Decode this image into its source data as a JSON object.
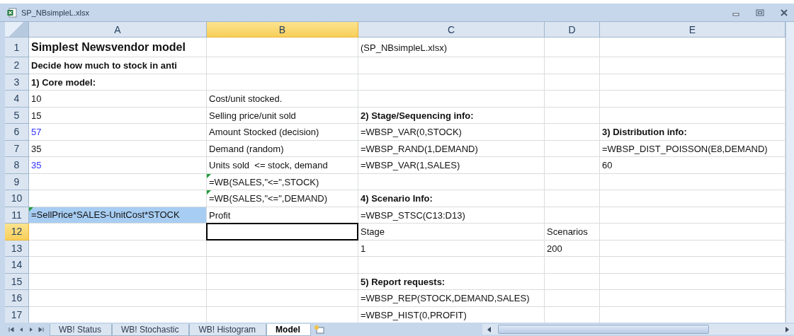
{
  "window": {
    "title": "SP_NBsimpleL.xlsx"
  },
  "columns": [
    {
      "label": "A",
      "selected": false
    },
    {
      "label": "B",
      "selected": true
    },
    {
      "label": "C",
      "selected": false
    },
    {
      "label": "D",
      "selected": false
    },
    {
      "label": "E",
      "selected": false
    }
  ],
  "rows": [
    {
      "label": "1",
      "selected": false,
      "a": {
        "text": "Simplest Newsvendor model",
        "kind": "title"
      },
      "c": {
        "text": "(SP_NBsimpleL.xlsx)",
        "kind": "text"
      }
    },
    {
      "label": "2",
      "selected": false,
      "a": {
        "text": "Decide how much to stock in anti",
        "kind": "heading"
      }
    },
    {
      "label": "3",
      "selected": false,
      "a": {
        "text": "1) Core model:",
        "kind": "heading"
      }
    },
    {
      "label": "4",
      "selected": false,
      "a": {
        "text": "10",
        "kind": "text"
      },
      "b": {
        "text": "Cost/unit stocked.",
        "kind": "text"
      }
    },
    {
      "label": "5",
      "selected": false,
      "a": {
        "text": "15",
        "kind": "text"
      },
      "b": {
        "text": "Selling price/unit sold",
        "kind": "text"
      },
      "c": {
        "text": "2) Stage/Sequencing info:",
        "kind": "heading"
      }
    },
    {
      "label": "6",
      "selected": false,
      "a": {
        "text": "57",
        "kind": "text",
        "color": "#3333ff"
      },
      "b": {
        "text": "Amount Stocked (decision)",
        "kind": "text"
      },
      "c": {
        "text": "=WBSP_VAR(0,STOCK)",
        "kind": "text"
      },
      "e": {
        "text": "3) Distribution info:",
        "kind": "heading"
      }
    },
    {
      "label": "7",
      "selected": false,
      "a": {
        "text": "35",
        "kind": "text"
      },
      "b": {
        "text": "Demand (random)",
        "kind": "text"
      },
      "c": {
        "text": "=WBSP_RAND(1,DEMAND)",
        "kind": "text"
      },
      "e": {
        "text": "=WBSP_DIST_POISSON(E8,DEMAND)",
        "kind": "text"
      }
    },
    {
      "label": "8",
      "selected": false,
      "a": {
        "text": "35",
        "kind": "text",
        "color": "#3333ff"
      },
      "b": {
        "text": "Units sold  <= stock, demand",
        "kind": "text"
      },
      "c": {
        "text": "=WBSP_VAR(1,SALES)",
        "kind": "text"
      },
      "e": {
        "text": "60",
        "kind": "text"
      }
    },
    {
      "label": "9",
      "selected": false,
      "b": {
        "text": "=WB(SALES,\"<=\",STOCK)",
        "kind": "text",
        "flagged": true
      }
    },
    {
      "label": "10",
      "selected": false,
      "b": {
        "text": "=WB(SALES,\"<=\",DEMAND)",
        "kind": "text",
        "flagged": true
      },
      "c": {
        "text": "4) Scenario Info:",
        "kind": "heading"
      }
    },
    {
      "label": "11",
      "selected": false,
      "a": {
        "text": "=SellPrice*SALES-UnitCost*STOCK",
        "kind": "text",
        "flagged": true,
        "highlighted": true
      },
      "b": {
        "text": "Profit",
        "kind": "text"
      },
      "c": {
        "text": "=WBSP_STSC(C13:D13)",
        "kind": "text"
      }
    },
    {
      "label": "12",
      "selected": true,
      "b": {
        "kind": "text",
        "active": true
      },
      "c": {
        "text": "Stage",
        "kind": "text"
      },
      "d": {
        "text": "Scenarios",
        "kind": "text"
      }
    },
    {
      "label": "13",
      "selected": false,
      "c": {
        "text": "1",
        "kind": "text"
      },
      "d": {
        "text": "200",
        "kind": "text"
      }
    },
    {
      "label": "14",
      "selected": false
    },
    {
      "label": "15",
      "selected": false,
      "c": {
        "text": "5) Report requests:",
        "kind": "heading"
      }
    },
    {
      "label": "16",
      "selected": false,
      "c": {
        "text": "=WBSP_REP(STOCK,DEMAND,SALES)",
        "kind": "text"
      }
    },
    {
      "label": "17",
      "selected": false,
      "c": {
        "text": "=WBSP_HIST(0,PROFIT)",
        "kind": "text"
      }
    }
  ],
  "sheet_tabs": [
    {
      "label": "WB! Status",
      "selected": false
    },
    {
      "label": "WB!  Stochastic",
      "selected": false
    },
    {
      "label": "WB!  Histogram",
      "selected": false
    },
    {
      "label": "Model",
      "selected": true
    }
  ]
}
